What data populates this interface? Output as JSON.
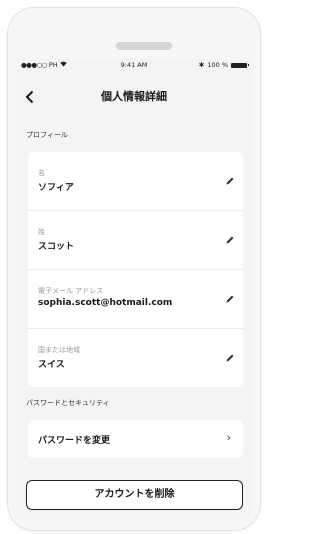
{
  "status_bar": {
    "carrier": "PH",
    "time": "9:41 AM",
    "battery": "100 %"
  },
  "header": {
    "back_icon": "chevron-left-icon",
    "title": "個人情報詳細"
  },
  "profile": {
    "section_label": "プロフィール",
    "fields": [
      {
        "label": "名",
        "value": "ソフィア"
      },
      {
        "label": "姓",
        "value": "スコット"
      },
      {
        "label": "電子メール アドレス",
        "value": "sophia.scott@hotmail.com"
      },
      {
        "label": "国または地域",
        "value": "スイス"
      }
    ]
  },
  "security": {
    "section_label": "パスワードとセキュリティ",
    "change_password_label": "パスワードを変更"
  },
  "delete_account_label": "アカウントを削除"
}
